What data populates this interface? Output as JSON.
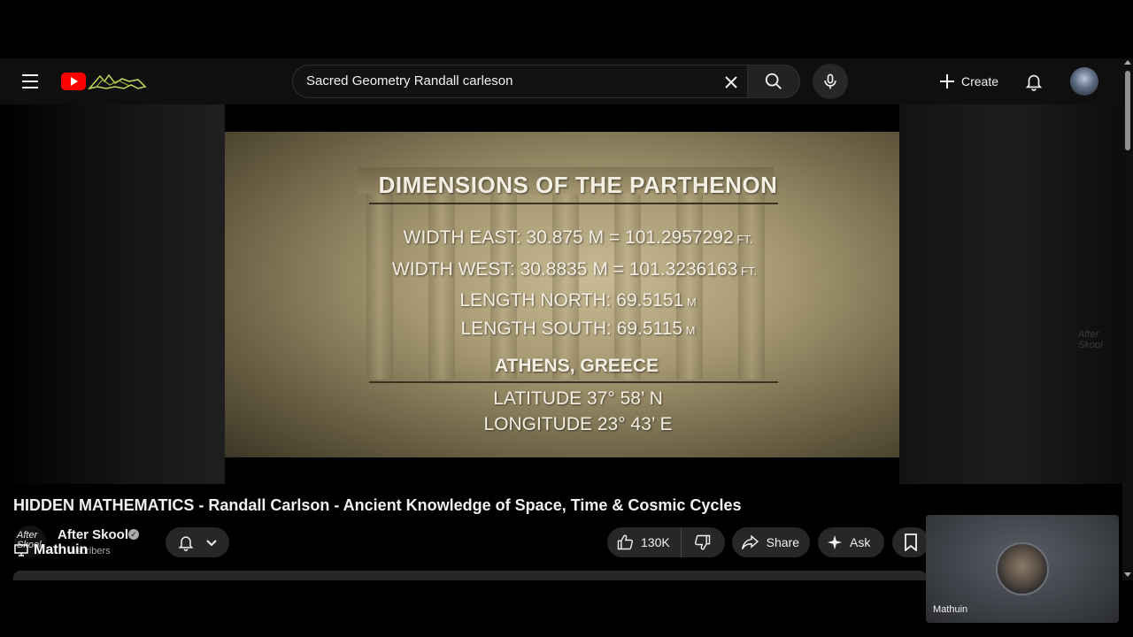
{
  "search": {
    "query": "Sacred Geometry Randall carleson"
  },
  "header": {
    "create_label": "Create"
  },
  "slide": {
    "title": "DIMENSIONS OF THE PARTHENON",
    "lines": [
      {
        "label": "WIDTH EAST: 30.875 M = ",
        "value": "101.2957292",
        "unit": " FT."
      },
      {
        "label": "WIDTH WEST: 30.8835 M = ",
        "value": "101.3236163",
        "unit": " FT."
      },
      {
        "label": "LENGTH NORTH: 69.5151",
        "value": "",
        "unit": " M"
      },
      {
        "label": "LENGTH SOUTH: 69.5115",
        "value": "",
        "unit": " M"
      }
    ],
    "location": "ATHENS, GREECE",
    "latitude": "LATITUDE  37° 58’ N",
    "longitude": "LONGITUDE  23° 43’ E"
  },
  "watermark": "After\nSkool",
  "video": {
    "title": "HIDDEN MATHEMATICS - Randall Carlson - Ancient Knowledge of Space, Time & Cosmic Cycles",
    "channel_name": "After Skool",
    "channel_avatar_text": "After\nSkool",
    "subscribers": "bscribers",
    "overlay_user": "Mathuin",
    "likes": "130K",
    "share_label": "Share",
    "ask_label": "Ask"
  },
  "webcam": {
    "name": "Mathuin"
  },
  "colors": {
    "brand_red": "#ff0000",
    "background": "#0f0f0f",
    "pill": "#272727"
  }
}
